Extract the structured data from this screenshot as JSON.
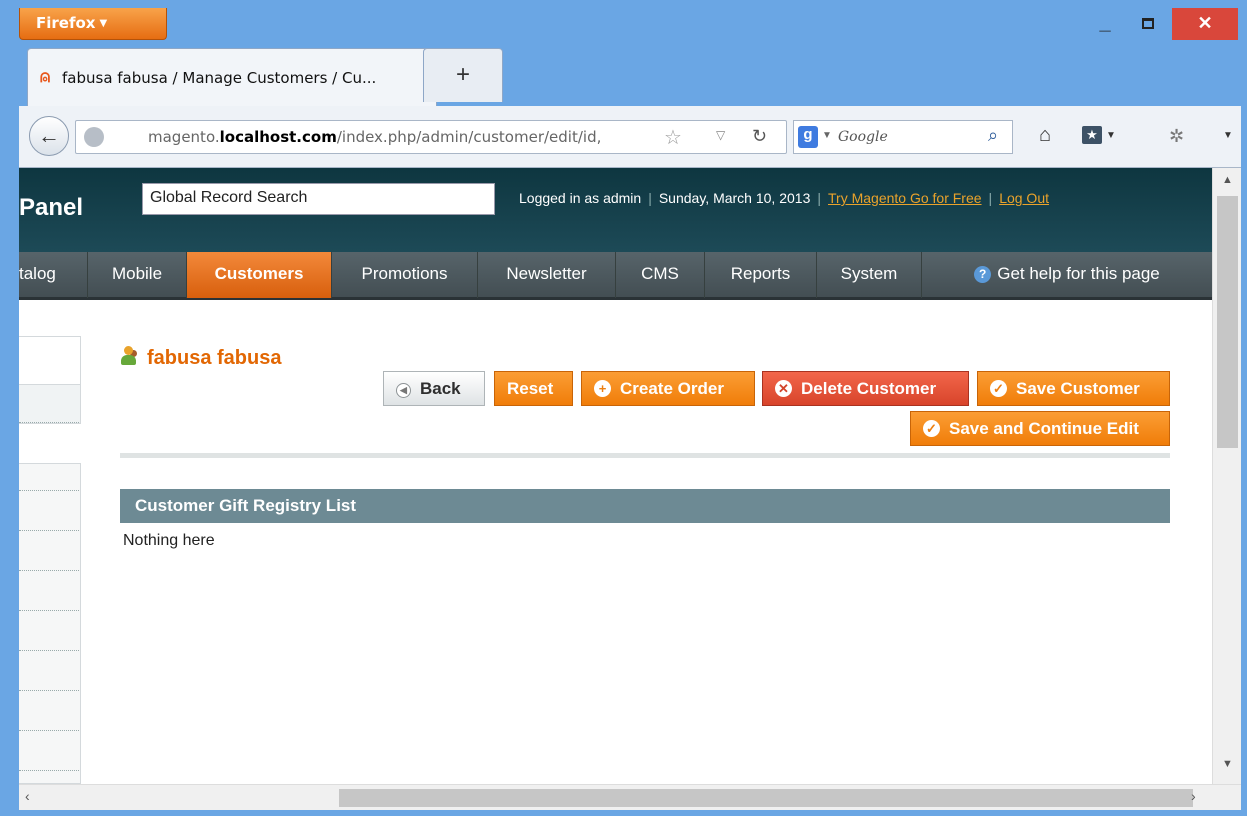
{
  "browser": {
    "menu_button": "Firefox",
    "menu_arrow": "▼",
    "tab_title": "fabusa fabusa / Manage Customers / Cu...",
    "new_tab": "+",
    "url_prefix": "magento.",
    "url_host": "localhost.com",
    "url_path": "/index.php/admin/customer/edit/id,",
    "search_placeholder": "Google",
    "window_minimize": "_",
    "window_close": "✕",
    "icons": [
      "firefox-menu-icon",
      "back-arrow-icon",
      "globe-icon",
      "star-icon",
      "reload-icon",
      "google-icon",
      "search-icon",
      "home-icon",
      "bookmarks-icon",
      "addon-icon",
      "menu-icon"
    ]
  },
  "header": {
    "title": "Panel",
    "global_search_value": "Global Record Search",
    "logged_in": "Logged in as admin",
    "date": "Sunday, March 10, 2013",
    "try_link": "Try Magento Go for Free",
    "logout_link": "Log Out"
  },
  "nav": {
    "items": [
      {
        "label": "talog",
        "active": false
      },
      {
        "label": "Mobile",
        "active": false
      },
      {
        "label": "Customers",
        "active": true
      },
      {
        "label": "Promotions",
        "active": false
      },
      {
        "label": "Newsletter",
        "active": false
      },
      {
        "label": "CMS",
        "active": false
      },
      {
        "label": "Reports",
        "active": false
      },
      {
        "label": "System",
        "active": false
      }
    ],
    "help": "Get help for this page"
  },
  "page": {
    "title": "fabusa fabusa",
    "buttons": {
      "back": "Back",
      "reset": "Reset",
      "create_order": "Create Order",
      "delete_customer": "Delete Customer",
      "save_customer": "Save Customer",
      "save_continue": "Save and Continue Edit"
    },
    "section_title": "Customer Gift Registry List",
    "empty_message": "Nothing here"
  },
  "colors": {
    "accent": "#f07d09",
    "header_bg": "#0e3640",
    "section_header": "#6d8a94",
    "delete": "#d8442b",
    "window_frame": "#6aa6e4"
  }
}
